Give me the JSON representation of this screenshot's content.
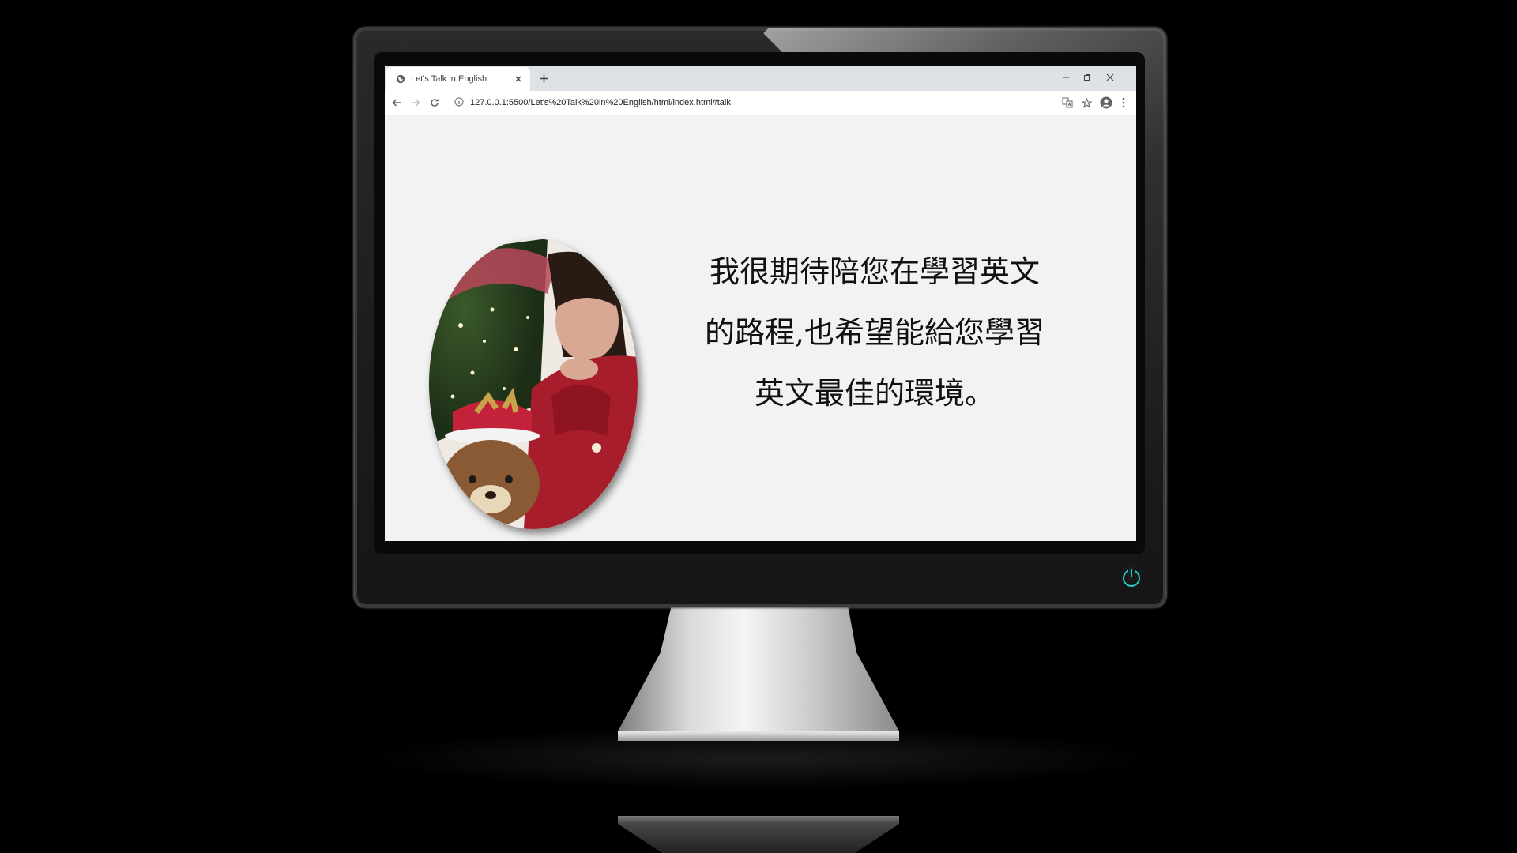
{
  "browser": {
    "tab_title": "Let's Talk in English",
    "url": "127.0.0.1:5500/Let's%20Talk%20in%20English/html/index.html#talk"
  },
  "page": {
    "intro_line_1": "我很期待陪您在學習英文",
    "intro_line_2": "的路程,也希望能給您學習",
    "intro_line_3": "英文最佳的環境。"
  },
  "colors": {
    "power_indicator": "#1fd1c8",
    "page_background": "#f2f2f2",
    "monitor_frame": "#1c1c1c"
  },
  "icons": {
    "tab_favicon": "globe-icon",
    "power": "power-icon"
  }
}
